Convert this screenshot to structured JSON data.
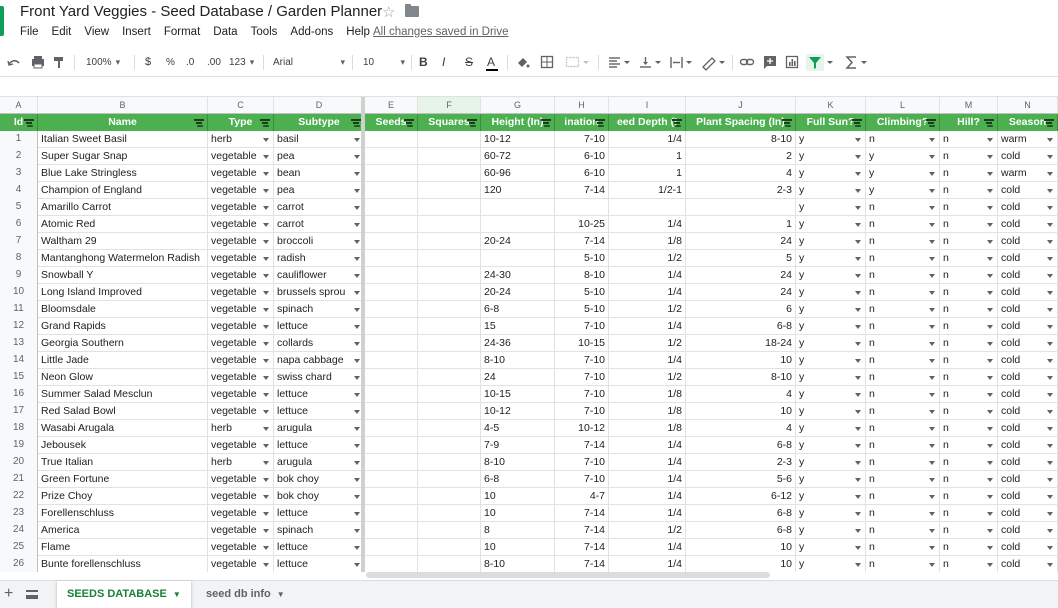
{
  "doc": {
    "title": "Front Yard Veggies - Seed Database / Garden Planner",
    "saved_status": "All changes saved in Drive"
  },
  "menu": [
    "File",
    "Edit",
    "View",
    "Insert",
    "Format",
    "Data",
    "Tools",
    "Add-ons",
    "Help"
  ],
  "toolbar": {
    "zoom": "100%",
    "currency": "$",
    "percent": "%",
    "dec_decrease": ".0",
    "dec_increase": ".00",
    "more_formats": "123",
    "font": "Arial",
    "font_size": "10",
    "bold": "B",
    "italic": "I",
    "strike": "S",
    "text_color": "A",
    "text_color_hex": "#000000",
    "icons": [
      "undo-icon",
      "print-icon",
      "paint-format-icon",
      "fill-color-icon",
      "borders-icon",
      "merge-icon",
      "align-icon",
      "valign-icon",
      "wrap-icon",
      "rotate-icon",
      "link-icon",
      "comment-icon",
      "chart-icon",
      "filter-icon",
      "functions-icon"
    ]
  },
  "colors": {
    "header_green": "#4caf50",
    "accent_green": "#188038",
    "filter_active": "#0f9d58"
  },
  "grid": {
    "column_letters": [
      "A",
      "B",
      "C",
      "D",
      "E",
      "F",
      "G",
      "H",
      "I",
      "J",
      "K",
      "L",
      "M",
      "N"
    ],
    "headers": [
      "Id",
      "Name",
      "Type",
      "Subtype",
      "Seeds",
      "Squares",
      "Height (In)",
      "ination",
      "eed Depth (I",
      "Plant Spacing (In)",
      "Full Sun?",
      "Climbing?",
      "Hill?",
      "Season"
    ],
    "rows": [
      [
        "1",
        "Italian Sweet Basil",
        "herb",
        "basil",
        "",
        "",
        "10-12",
        "7-10",
        "1/4",
        "8-10",
        "y",
        "n",
        "n",
        "warm"
      ],
      [
        "2",
        "Super Sugar Snap",
        "vegetable",
        "pea",
        "",
        "",
        "60-72",
        "6-10",
        "1",
        "2",
        "y",
        "y",
        "n",
        "cold"
      ],
      [
        "3",
        "Blue Lake Stringless",
        "vegetable",
        "bean",
        "",
        "",
        "60-96",
        "6-10",
        "1",
        "4",
        "y",
        "y",
        "n",
        "warm"
      ],
      [
        "4",
        "Champion of England",
        "vegetable",
        "pea",
        "",
        "",
        "120",
        "7-14",
        "1/2-1",
        "2-3",
        "y",
        "y",
        "n",
        "cold"
      ],
      [
        "5",
        "Amarillo Carrot",
        "vegetable",
        "carrot",
        "",
        "",
        "",
        "",
        "",
        "",
        "y",
        "n",
        "n",
        "cold"
      ],
      [
        "6",
        "Atomic Red",
        "vegetable",
        "carrot",
        "",
        "",
        "",
        "10-25",
        "1/4",
        "1",
        "y",
        "n",
        "n",
        "cold"
      ],
      [
        "7",
        "Waltham 29",
        "vegetable",
        "broccoli",
        "",
        "",
        "20-24",
        "7-14",
        "1/8",
        "24",
        "y",
        "n",
        "n",
        "cold"
      ],
      [
        "8",
        "Mantanghong Watermelon Radish",
        "vegetable",
        "radish",
        "",
        "",
        "",
        "5-10",
        "1/2",
        "5",
        "y",
        "n",
        "n",
        "cold"
      ],
      [
        "9",
        "Snowball Y",
        "vegetable",
        "cauliflower",
        "",
        "",
        "24-30",
        "8-10",
        "1/4",
        "24",
        "y",
        "n",
        "n",
        "cold"
      ],
      [
        "10",
        "Long Island Improved",
        "vegetable",
        "brussels sprou",
        "",
        "",
        "20-24",
        "5-10",
        "1/4",
        "24",
        "y",
        "n",
        "n",
        "cold"
      ],
      [
        "11",
        "Bloomsdale",
        "vegetable",
        "spinach",
        "",
        "",
        "6-8",
        "5-10",
        "1/2",
        "6",
        "y",
        "n",
        "n",
        "cold"
      ],
      [
        "12",
        "Grand Rapids",
        "vegetable",
        "lettuce",
        "",
        "",
        "15",
        "7-10",
        "1/4",
        "6-8",
        "y",
        "n",
        "n",
        "cold"
      ],
      [
        "13",
        "Georgia Southern",
        "vegetable",
        "collards",
        "",
        "",
        "24-36",
        "10-15",
        "1/2",
        "18-24",
        "y",
        "n",
        "n",
        "cold"
      ],
      [
        "14",
        "Little Jade",
        "vegetable",
        "napa cabbage",
        "",
        "",
        "8-10",
        "7-10",
        "1/4",
        "10",
        "y",
        "n",
        "n",
        "cold"
      ],
      [
        "15",
        "Neon Glow",
        "vegetable",
        "swiss chard",
        "",
        "",
        "24",
        "7-10",
        "1/2",
        "8-10",
        "y",
        "n",
        "n",
        "cold"
      ],
      [
        "16",
        "Summer Salad Mesclun",
        "vegetable",
        "lettuce",
        "",
        "",
        "10-15",
        "7-10",
        "1/8",
        "4",
        "y",
        "n",
        "n",
        "cold"
      ],
      [
        "17",
        "Red Salad Bowl",
        "vegetable",
        "lettuce",
        "",
        "",
        "10-12",
        "7-10",
        "1/8",
        "10",
        "y",
        "n",
        "n",
        "cold"
      ],
      [
        "18",
        "Wasabi Arugala",
        "herb",
        "arugula",
        "",
        "",
        "4-5",
        "10-12",
        "1/8",
        "4",
        "y",
        "n",
        "n",
        "cold"
      ],
      [
        "19",
        "Jebousek",
        "vegetable",
        "lettuce",
        "",
        "",
        "7-9",
        "7-14",
        "1/4",
        "6-8",
        "y",
        "n",
        "n",
        "cold"
      ],
      [
        "20",
        "True Italian",
        "herb",
        "arugula",
        "",
        "",
        "8-10",
        "7-10",
        "1/4",
        "2-3",
        "y",
        "n",
        "n",
        "cold"
      ],
      [
        "21",
        "Green Fortune",
        "vegetable",
        "bok choy",
        "",
        "",
        "6-8",
        "7-10",
        "1/4",
        "5-6",
        "y",
        "n",
        "n",
        "cold"
      ],
      [
        "22",
        "Prize Choy",
        "vegetable",
        "bok choy",
        "",
        "",
        "10",
        "4-7",
        "1/4",
        "6-12",
        "y",
        "n",
        "n",
        "cold"
      ],
      [
        "23",
        "Forellenschluss",
        "vegetable",
        "lettuce",
        "",
        "",
        "10",
        "7-14",
        "1/4",
        "6-8",
        "y",
        "n",
        "n",
        "cold"
      ],
      [
        "24",
        "America",
        "vegetable",
        "spinach",
        "",
        "",
        "8",
        "7-14",
        "1/2",
        "6-8",
        "y",
        "n",
        "n",
        "cold"
      ],
      [
        "25",
        "Flame",
        "vegetable",
        "lettuce",
        "",
        "",
        "10",
        "7-14",
        "1/4",
        "10",
        "y",
        "n",
        "n",
        "cold"
      ],
      [
        "26",
        "Bunte forellenschluss",
        "vegetable",
        "lettuce",
        "",
        "",
        "8-10",
        "7-14",
        "1/4",
        "10",
        "y",
        "n",
        "n",
        "cold"
      ]
    ]
  },
  "sheets": [
    {
      "label": "SEEDS DATABASE",
      "active": true
    },
    {
      "label": "seed db info",
      "active": false
    }
  ]
}
